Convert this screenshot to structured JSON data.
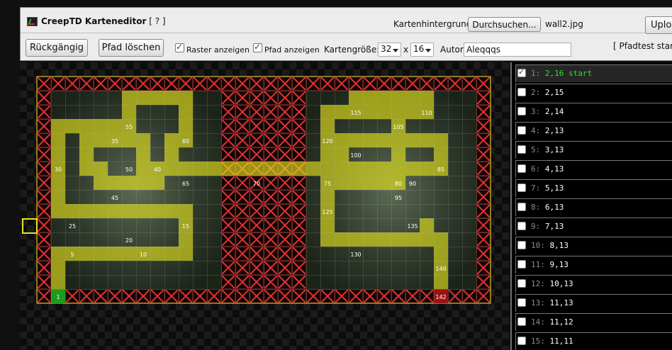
{
  "toolbar": {
    "title": "CreepTD Karteneditor",
    "help": "[ ? ]",
    "background_label": "Kartenhintergrund:",
    "browse_label": "Durchsuchen...",
    "background_file": "wall2.jpg",
    "upload_label": "Uplo",
    "undo_label": "Rückgängig",
    "clear_path_label": "Pfad löschen",
    "show_grid_label": "Raster anzeigen",
    "show_grid_checked": true,
    "show_path_label": "Pfad anzeigen",
    "show_path_checked": true,
    "map_size_label": "Kartengröße:",
    "map_width": "32",
    "map_size_x": "x",
    "map_height": "16",
    "author_label": "Autor:",
    "author_value": "Aleqqqs",
    "pathtest_status": "[ Pfadtest starte"
  },
  "map": {
    "columns": 32,
    "rows": 16,
    "path": [
      [
        2,
        16
      ],
      [
        2,
        15
      ],
      [
        2,
        14
      ],
      [
        2,
        13
      ],
      [
        3,
        13
      ],
      [
        4,
        13
      ],
      [
        5,
        13
      ],
      [
        6,
        13
      ],
      [
        7,
        13
      ],
      [
        8,
        13
      ],
      [
        9,
        13
      ],
      [
        10,
        13
      ],
      [
        11,
        13
      ],
      [
        11,
        12
      ],
      [
        11,
        11
      ],
      [
        11,
        10
      ],
      [
        10,
        10
      ],
      [
        9,
        10
      ],
      [
        8,
        10
      ],
      [
        7,
        10
      ],
      [
        6,
        10
      ],
      [
        5,
        10
      ],
      [
        4,
        10
      ],
      [
        3,
        10
      ],
      [
        2,
        10
      ],
      [
        2,
        9
      ],
      [
        2,
        8
      ],
      [
        2,
        7
      ],
      [
        2,
        6
      ],
      [
        2,
        5
      ],
      [
        2,
        4
      ],
      [
        3,
        4
      ],
      [
        4,
        4
      ],
      [
        5,
        4
      ],
      [
        6,
        4
      ],
      [
        7,
        4
      ],
      [
        7,
        3
      ],
      [
        7,
        2
      ],
      [
        8,
        2
      ],
      [
        9,
        2
      ],
      [
        10,
        2
      ],
      [
        11,
        2
      ],
      [
        11,
        3
      ],
      [
        11,
        4
      ],
      [
        11,
        5
      ],
      [
        10,
        5
      ],
      [
        10,
        6
      ],
      [
        10,
        7
      ],
      [
        9,
        7
      ],
      [
        8,
        7
      ],
      [
        8,
        6
      ],
      [
        8,
        5
      ],
      [
        7,
        5
      ],
      [
        6,
        5
      ],
      [
        5,
        5
      ],
      [
        4,
        5
      ],
      [
        4,
        6
      ],
      [
        4,
        7
      ],
      [
        5,
        7
      ],
      [
        5,
        8
      ],
      [
        6,
        8
      ],
      [
        7,
        8
      ],
      [
        8,
        8
      ],
      [
        9,
        8
      ],
      [
        9,
        7
      ],
      [
        10,
        7
      ],
      [
        11,
        7
      ],
      [
        12,
        7
      ],
      [
        13,
        7
      ],
      [
        14,
        7
      ],
      [
        15,
        7
      ],
      [
        16,
        7
      ],
      [
        17,
        7
      ],
      [
        18,
        7
      ],
      [
        19,
        7
      ],
      [
        20,
        7
      ],
      [
        21,
        7
      ],
      [
        22,
        7
      ],
      [
        23,
        7
      ],
      [
        24,
        7
      ],
      [
        25,
        7
      ],
      [
        26,
        7
      ],
      [
        27,
        7
      ],
      [
        28,
        7
      ],
      [
        29,
        7
      ],
      [
        29,
        6
      ],
      [
        29,
        5
      ],
      [
        28,
        5
      ],
      [
        27,
        5
      ],
      [
        26,
        5
      ],
      [
        26,
        6
      ],
      [
        26,
        7
      ],
      [
        26,
        8
      ],
      [
        25,
        8
      ],
      [
        24,
        8
      ],
      [
        23,
        8
      ],
      [
        22,
        8
      ],
      [
        22,
        7
      ],
      [
        22,
        6
      ],
      [
        22,
        5
      ],
      [
        23,
        5
      ],
      [
        24,
        5
      ],
      [
        25,
        5
      ],
      [
        26,
        5
      ],
      [
        26,
        4
      ],
      [
        26,
        3
      ],
      [
        26,
        2
      ],
      [
        25,
        2
      ],
      [
        24,
        2
      ],
      [
        23,
        2
      ],
      [
        24,
        2
      ],
      [
        25,
        2
      ],
      [
        26,
        2
      ],
      [
        27,
        2
      ],
      [
        28,
        2
      ],
      [
        28,
        3
      ],
      [
        27,
        3
      ],
      [
        26,
        3
      ],
      [
        25,
        3
      ],
      [
        24,
        3
      ],
      [
        23,
        3
      ],
      [
        22,
        3
      ],
      [
        21,
        3
      ],
      [
        21,
        4
      ],
      [
        21,
        5
      ],
      [
        21,
        6
      ],
      [
        21,
        7
      ],
      [
        21,
        8
      ],
      [
        21,
        9
      ],
      [
        21,
        10
      ],
      [
        21,
        11
      ],
      [
        21,
        12
      ],
      [
        22,
        12
      ],
      [
        23,
        12
      ],
      [
        24,
        12
      ],
      [
        25,
        12
      ],
      [
        26,
        12
      ],
      [
        27,
        12
      ],
      [
        28,
        12
      ],
      [
        28,
        11
      ],
      [
        28,
        12
      ],
      [
        29,
        12
      ],
      [
        29,
        13
      ],
      [
        29,
        14
      ],
      [
        29,
        15
      ],
      [
        29,
        16
      ]
    ],
    "step_labels": [
      {
        "step": "1",
        "cell": [
          2,
          16
        ],
        "kind": "start"
      },
      {
        "step": "5",
        "cell": [
          3,
          13
        ]
      },
      {
        "step": "10",
        "cell": [
          8,
          13
        ]
      },
      {
        "step": "15",
        "cell": [
          11,
          11
        ]
      },
      {
        "step": "20",
        "cell": [
          7,
          12
        ]
      },
      {
        "step": "25",
        "cell": [
          3,
          11
        ]
      },
      {
        "step": "30",
        "cell": [
          2,
          7
        ]
      },
      {
        "step": "35",
        "cell": [
          6,
          5
        ]
      },
      {
        "step": "40",
        "cell": [
          9,
          7
        ]
      },
      {
        "step": "45",
        "cell": [
          6,
          9
        ]
      },
      {
        "step": "50",
        "cell": [
          7,
          7
        ]
      },
      {
        "step": "55",
        "cell": [
          7,
          4
        ]
      },
      {
        "step": "60",
        "cell": [
          11,
          5
        ]
      },
      {
        "step": "65",
        "cell": [
          11,
          8
        ]
      },
      {
        "step": "70",
        "cell": [
          16,
          8
        ]
      },
      {
        "step": "75",
        "cell": [
          21,
          8
        ]
      },
      {
        "step": "80",
        "cell": [
          26,
          8
        ]
      },
      {
        "step": "85",
        "cell": [
          29,
          7
        ]
      },
      {
        "step": "90",
        "cell": [
          27,
          8
        ]
      },
      {
        "step": "95",
        "cell": [
          26,
          9
        ]
      },
      {
        "step": "100",
        "cell": [
          23,
          6
        ]
      },
      {
        "step": "105",
        "cell": [
          26,
          4
        ]
      },
      {
        "step": "110",
        "cell": [
          28,
          3
        ]
      },
      {
        "step": "115",
        "cell": [
          23,
          3
        ]
      },
      {
        "step": "120",
        "cell": [
          21,
          5
        ]
      },
      {
        "step": "125",
        "cell": [
          21,
          10
        ]
      },
      {
        "step": "130",
        "cell": [
          23,
          13
        ]
      },
      {
        "step": "135",
        "cell": [
          27,
          11
        ]
      },
      {
        "step": "140",
        "cell": [
          29,
          14
        ]
      },
      {
        "step": "142",
        "cell": [
          29,
          16
        ],
        "kind": "end"
      }
    ]
  },
  "path_points": [
    {
      "index": "1:",
      "coords": "2,16",
      "note": "start",
      "checked": true
    },
    {
      "index": "2:",
      "coords": "2,15",
      "checked": false
    },
    {
      "index": "3:",
      "coords": "2,14",
      "checked": false
    },
    {
      "index": "4:",
      "coords": "2,13",
      "checked": false
    },
    {
      "index": "5:",
      "coords": "3,13",
      "checked": false
    },
    {
      "index": "6:",
      "coords": "4,13",
      "checked": false
    },
    {
      "index": "7:",
      "coords": "5,13",
      "checked": false
    },
    {
      "index": "8:",
      "coords": "6,13",
      "checked": false
    },
    {
      "index": "9:",
      "coords": "7,13",
      "checked": false
    },
    {
      "index": "10:",
      "coords": "8,13",
      "checked": false
    },
    {
      "index": "11:",
      "coords": "9,13",
      "checked": false
    },
    {
      "index": "12:",
      "coords": "10,13",
      "checked": false
    },
    {
      "index": "13:",
      "coords": "11,13",
      "checked": false
    },
    {
      "index": "14:",
      "coords": "11,12",
      "checked": false
    },
    {
      "index": "15:",
      "coords": "11,11",
      "checked": false
    }
  ],
  "colors": {
    "path": "#e8e61c",
    "blocked": "#e03030",
    "start": "#1c9a1c",
    "end": "#9a1414",
    "point_green": "#33dd33"
  }
}
